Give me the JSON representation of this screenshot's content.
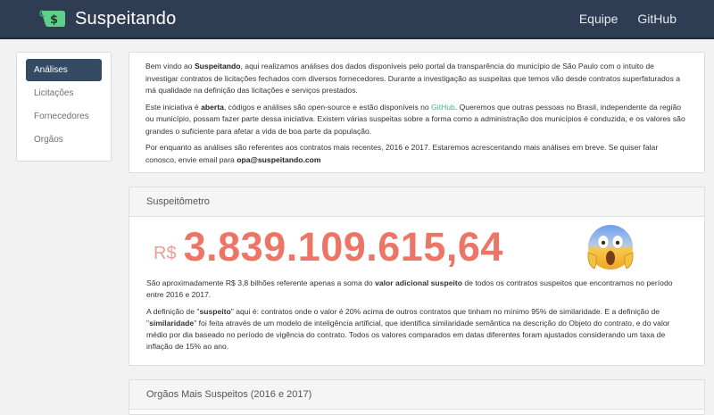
{
  "brand": {
    "name": "Suspeitando",
    "logo_icon": "dollar-ticket-icon",
    "logo_color": "#5fd08a"
  },
  "nav": {
    "links": [
      "Equipe",
      "GitHub"
    ]
  },
  "sidebar": {
    "items": [
      {
        "label": "Análises",
        "active": true
      },
      {
        "label": "Licitações",
        "active": false
      },
      {
        "label": "Fornecedores",
        "active": false
      },
      {
        "label": "Orgãos",
        "active": false
      }
    ]
  },
  "intro": {
    "p1_a": "Bem vindo ao ",
    "p1_b": "Suspeitando",
    "p1_c": ", aqui realizamos análises dos dados disponíveis pelo portal da transparência do município de São Paulo com o intuito de investigar contratos de licitações fechados com diversos fornecedores. Durante a investigação as suspeitas que temos vão desde contratos superfaturados a má qualidade na definição das licitações e serviços prestados.",
    "p2_a": "Este iniciativa é ",
    "p2_b": "aberta",
    "p2_c": ", códigos e análises são open-source e estão disponíveis no ",
    "p2_link": "GitHub",
    "p2_d": ". Queremos que outras pessoas no Brasil, independente da região ou município, possam fazer parte dessa iniciativa. Existem várias suspeitas sobre a forma como a administração dos municípios é conduzida, e os valores são grandes o suficiente para afetar a vida de boa parte da população.",
    "p3_a": "Por enquanto as análises são referentes aos contratos mais recentes, 2016 e 2017. Estaremos acrescentando mais análises em breve. Se quiser falar conosco, envie email para ",
    "p3_email": "opa@suspeitando.com"
  },
  "meter": {
    "title": "Suspeitômetro",
    "currency": "R$",
    "amount": "3.839.109.615,64",
    "emoji_icon": "face-screaming-in-fear-icon",
    "p1_a": "São aproximadamente R$ 3,8 bilhões referente apenas a soma do ",
    "p1_b": "valor adicional suspeito",
    "p1_c": " de todos os contratos suspeitos que encontramos no período entre 2016 e 2017.",
    "p2_a": "A definição de \"",
    "p2_b": "suspeito",
    "p2_c": "\" aqui é: contratos onde o valor é 20% acima de outros contratos que tinham no mínimo 95% de similaridade. E a definição de \"",
    "p2_d": "similaridade",
    "p2_e": "\" foi feita através de um modelo de inteligência artificial, que identifica similaridade semântica na descrição do Objeto do contrato, e do valor médio por dia baseado no período de vigência do contrato. Todos os valores comparados em datas diferentes foram ajustados considerando um taxa de inflação de 15% ao ano."
  },
  "orgaos": {
    "title": "Orgãos Mais Suspeitos (2016 e 2017)"
  },
  "colors": {
    "navbar": "#2e3d52",
    "active": "#354a63",
    "amount": "#ec7566",
    "link": "#46b08a"
  }
}
